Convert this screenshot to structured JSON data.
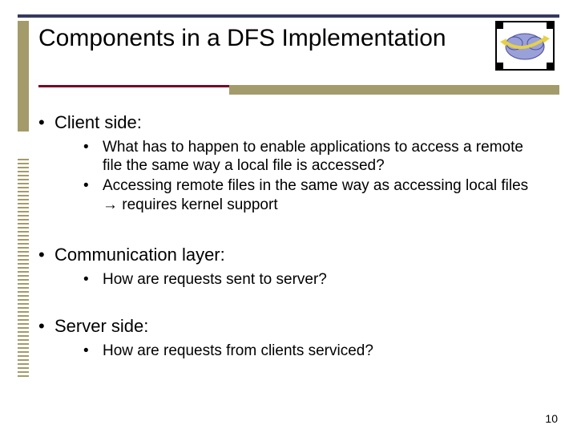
{
  "title": "Components in a DFS Implementation",
  "sections": [
    {
      "heading": "Client side:",
      "bullets": [
        "What has to happen to enable applications to access a remote file the same way a local file is accessed?",
        "Accessing remote files in the same way as accessing local files → requires kernel support"
      ],
      "mt": ""
    },
    {
      "heading": " Communication layer:",
      "bullets": [
        "How are requests sent to server?"
      ],
      "mt": "mt-comm"
    },
    {
      "heading": "Server side:",
      "bullets": [
        "How are requests from clients serviced?"
      ],
      "mt": "mt-serv"
    }
  ],
  "page_number": "10"
}
